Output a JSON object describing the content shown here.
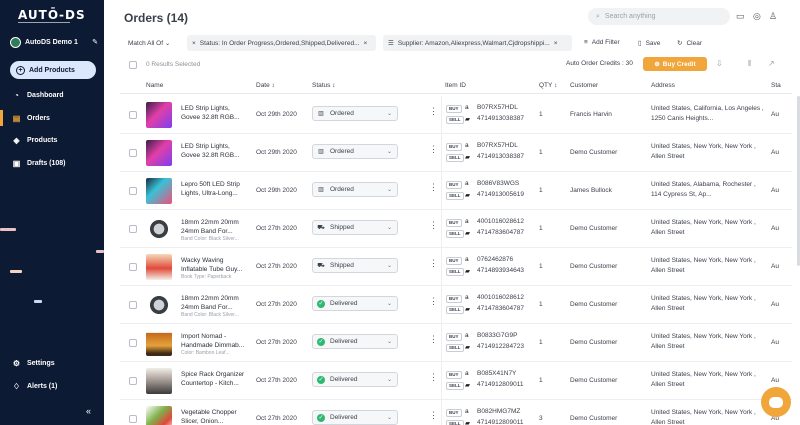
{
  "colors": {
    "sidebar_bg": "#0d1a33",
    "accent": "#f0a63b",
    "delivered": "#2eb872"
  },
  "sidebar": {
    "logo": "AUTŌ-DS",
    "store_name": "AutoDS Demo 1",
    "add_products": "Add Products",
    "nav": [
      {
        "label": "Dashboard",
        "icon": "speedometer-icon"
      },
      {
        "label": "Orders",
        "icon": "orders-icon",
        "active": true
      },
      {
        "label": "Products",
        "icon": "box-icon"
      },
      {
        "label": "Drafts (108)",
        "icon": "drafts-icon"
      }
    ],
    "bottom_nav": [
      {
        "label": "Settings",
        "icon": "gear-icon"
      },
      {
        "label": "Alerts (1)",
        "icon": "bell-icon"
      }
    ],
    "collapse_glyph": "«"
  },
  "header": {
    "title": "Orders (14)",
    "search_placeholder": "Search anything"
  },
  "filters": {
    "match": "Match All Of",
    "chips": [
      "Status: In Order Progress,Ordered,Shipped,Delivered...",
      "Supplier: Amazon,Aliexpress,Walmart,Cjdropshippi..."
    ],
    "add_filter": "Add Filter",
    "save": "Save",
    "clear": "Clear"
  },
  "selection": {
    "text": "0 Results Selected",
    "credits": "Auto Order Credits : 30",
    "buy_credit": "Buy Credit"
  },
  "table": {
    "columns": [
      "Name",
      "Date",
      "Status",
      "Item ID",
      "QTY",
      "Customer",
      "Address",
      "Sta"
    ],
    "buy_tag": "BUY",
    "sell_tag": "SELL",
    "rows": [
      {
        "name": "LED Strip Lights, Govee 32.8ft RGB...",
        "variant": "",
        "date": "Oct 29th 2020",
        "status": "Ordered",
        "buy_id": "B07RX57HDL",
        "sell_id": "4714913038387",
        "qty": "1",
        "customer": "Francis Harvin",
        "address": "United States, California, Los Angeles , 1250 Canis Heights...",
        "status_col": "Au",
        "thumb": "led"
      },
      {
        "name": "LED Strip Lights, Govee 32.8ft RGB...",
        "variant": "",
        "date": "Oct 29th 2020",
        "status": "Ordered",
        "buy_id": "B07RX57HDL",
        "sell_id": "4714913038387",
        "qty": "1",
        "customer": "Demo Customer",
        "address": "United States, New York, New York , Allen Street",
        "status_col": "Au",
        "thumb": "led"
      },
      {
        "name": "Lepro 50ft LED Strip Lights, Ultra-Long...",
        "variant": "",
        "date": "Oct 29th 2020",
        "status": "Ordered",
        "buy_id": "B086V83WGS",
        "sell_id": "4714913005619",
        "qty": "1",
        "customer": "James Bullock",
        "address": "United States, Alabama, Rochester , 114 Cypress St, Ap...",
        "status_col": "Au",
        "thumb": "lepro"
      },
      {
        "name": "18mm 22mm 20mm 24mm Band For...",
        "variant": "Band Color: Black Silver...",
        "date": "Oct 27th 2020",
        "status": "Shipped",
        "buy_id": "4001016028612",
        "sell_id": "4714783604787",
        "qty": "1",
        "customer": "Demo Customer",
        "address": "United States, New York, New York , Allen Street",
        "status_col": "Au",
        "thumb": "band"
      },
      {
        "name": "Wacky Waving Inflatable Tube Guy...",
        "variant": "Book Type: Paperback",
        "date": "Oct 27th 2020",
        "status": "Shipped",
        "buy_id": "0762462876",
        "sell_id": "4714893934643",
        "qty": "1",
        "customer": "Demo Customer",
        "address": "United States, New York, New York , Allen Street",
        "status_col": "Au",
        "thumb": "book"
      },
      {
        "name": "18mm 22mm 20mm 24mm Band For...",
        "variant": "Band Color: Black Silver...",
        "date": "Oct 27th 2020",
        "status": "Delivered",
        "buy_id": "4001016028612",
        "sell_id": "4714783604787",
        "qty": "1",
        "customer": "Demo Customer",
        "address": "United States, New York, New York , Allen Street",
        "status_col": "Au",
        "thumb": "band"
      },
      {
        "name": "Import Nomad - Handmade Dimmab...",
        "variant": "Color: Bamboo Leaf...",
        "date": "Oct 27th 2020",
        "status": "Delivered",
        "buy_id": "B0833G7G9P",
        "sell_id": "4714912284723",
        "qty": "1",
        "customer": "Demo Customer",
        "address": "United States, New York, New York , Allen Street",
        "status_col": "Au",
        "thumb": "lamp"
      },
      {
        "name": "Spice Rack Organizer Countertop - Kitch...",
        "variant": "",
        "date": "Oct 27th 2020",
        "status": "Delivered",
        "buy_id": "B085X41N7Y",
        "sell_id": "4714912809011",
        "qty": "1",
        "customer": "Demo Customer",
        "address": "United States, New York, New York , Allen Street",
        "status_col": "Au",
        "thumb": "spice"
      },
      {
        "name": "Vegetable Chopper Slicer, Onion...",
        "variant": "",
        "date": "Oct 27th 2020",
        "status": "Delivered",
        "buy_id": "B082HMG7MZ",
        "sell_id": "4714912809011",
        "qty": "3",
        "customer": "Demo Customer",
        "address": "United States, New York, New York , Allen Street",
        "status_col": "Au",
        "thumb": "veg"
      }
    ]
  }
}
